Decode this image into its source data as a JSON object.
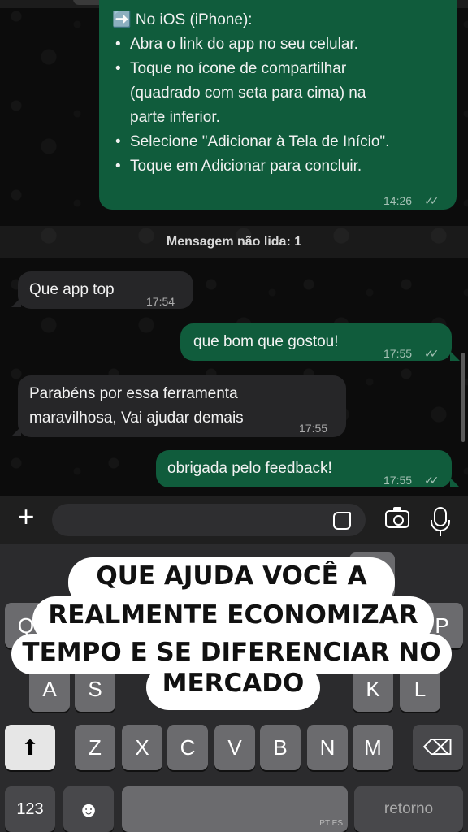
{
  "messages": {
    "ios_header": "➡️ No iOS (iPhone):",
    "ios_bullets": [
      "Abra o link do app no seu celular.",
      "Toque no ícone de compartilhar",
      "(quadrado com seta para cima) na",
      "parte inferior.",
      "Selecione \"Adicionar à Tela de Início\".",
      "Toque em Adicionar para concluir."
    ],
    "ios_time": "14:26",
    "unread_label": "Mensagem não lida: 1",
    "m1_text": "Que app top",
    "m1_time": "17:54",
    "m2_text": "que bom que gostou!",
    "m2_time": "17:55",
    "m3_line1": "Parabéns por essa ferramenta",
    "m3_line2": "maravilhosa, Vai ajudar demais",
    "m3_time": "17:55",
    "m4_text": "obrigada pelo feedback!",
    "m4_time": "17:55",
    "read_ticks": "✓✓"
  },
  "input": {
    "plus_icon": "+"
  },
  "keyboard": {
    "row_hidden_left": "Q",
    "row_hidden_right": "P",
    "row_hidden_mid": "E",
    "row2": [
      "A",
      "S",
      "K",
      "L"
    ],
    "row3": [
      "Z",
      "X",
      "C",
      "V",
      "B",
      "N",
      "M"
    ],
    "key_123": "123",
    "key_return": "retorno",
    "lang": "PT ES",
    "delete_icon": "⌫",
    "shift_icon": "⬆",
    "emoji_icon": "☻"
  },
  "overlay": {
    "line1": "QUE AJUDA VOCÊ A",
    "line2": "REALMENTE ECONOMIZAR",
    "line3": "TEMPO E SE DIFERENCIAR NO",
    "line4": "MERCADO"
  },
  "colors": {
    "outgoing_bubble": "#105c3c",
    "incoming_bubble": "#262628",
    "chat_bg": "#0c0c0c"
  }
}
